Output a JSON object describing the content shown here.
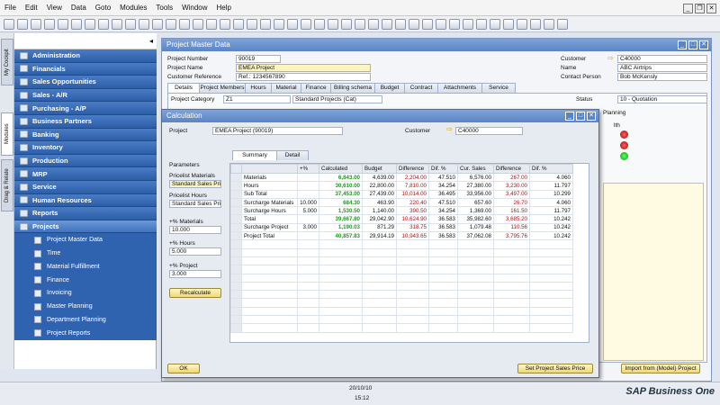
{
  "menu": [
    "File",
    "Edit",
    "View",
    "Data",
    "Goto",
    "Modules",
    "Tools",
    "Window",
    "Help"
  ],
  "sidetabs": [
    "My Cockpit",
    "Modules",
    "Drag & Relate"
  ],
  "modules": [
    "Administration",
    "Financials",
    "Sales Opportunities",
    "Sales - A/R",
    "Purchasing - A/P",
    "Business Partners",
    "Banking",
    "Inventory",
    "Production",
    "MRP",
    "Service",
    "Human Resources",
    "Reports",
    "Projects"
  ],
  "projects_sub": [
    "Project Master Data",
    "Time",
    "Material Fulfillment",
    "Finance",
    "Invoicing",
    "Master Planning",
    "Department Planning",
    "Project Reports"
  ],
  "pmd": {
    "title": "Project Master Data",
    "labels": {
      "number": "Project Number",
      "name": "Project Name",
      "ref": "Customer Reference",
      "customer": "Customer",
      "cname": "Name",
      "contact": "Contact Person",
      "category": "Project Category",
      "status": "Status",
      "planning": "Planning",
      "health": "lth"
    },
    "values": {
      "number": "90019",
      "name": "EMEA Project",
      "ref": "Ref.: 1234567890",
      "customer": "C40000",
      "cname": "ABC Airtrips",
      "contact": "Bob McKensly",
      "category": "Z1",
      "category_desc": "Standard Projects (Cat)",
      "status": "10 - Quotation"
    },
    "tabs": [
      "Details",
      "Project Members",
      "Hours",
      "Material",
      "Finance",
      "Billing schema",
      "Budget",
      "Contract",
      "Attachments",
      "Service"
    ],
    "import_btn": "Import from (Model) Project"
  },
  "calc": {
    "title": "Calculation",
    "project_label": "Project",
    "project_value": "EMEA Project (90019)",
    "customer_label": "Customer",
    "customer_value": "C40000",
    "tabs": [
      "Summary",
      "Detail"
    ],
    "params": "Parameters",
    "pricelist_mat_label": "Pricelist Materials",
    "pricelist_mat": "Standard Sales Pric",
    "pricelist_hours_label": "Pricelist Hours",
    "pricelist_hours": "Standard Sales Pric",
    "pm_label": "+% Materials",
    "pm": "10.000",
    "ph_label": "+% Hours",
    "ph": "5.000",
    "pp_label": "+% Project",
    "pp": "3.000",
    "recalc": "Recalculate",
    "ok": "OK",
    "set_price": "Set Project Sales Price",
    "columns": [
      "",
      "+%",
      "Calculated",
      "Budget",
      "Difference",
      "Dif. %",
      "Cur. Sales",
      "Difference",
      "Dif. %"
    ],
    "rows": [
      [
        "Materials",
        "",
        "6,843.00",
        "4,639.00",
        "2,204.00",
        "47.510",
        "6,576.00",
        "267.00",
        "4.060"
      ],
      [
        "Hours",
        "",
        "30,610.00",
        "22,800.00",
        "7,810.00",
        "34.254",
        "27,380.00",
        "3,230.00",
        "11.797"
      ],
      [
        "Sub Total",
        "",
        "37,453.00",
        "27,439.00",
        "10,014.00",
        "36.495",
        "33,956.00",
        "3,497.00",
        "10.299"
      ],
      [
        "Surcharge Materials",
        "10.000",
        "684.30",
        "463.90",
        "220.40",
        "47.510",
        "657.60",
        "26.70",
        "4.060"
      ],
      [
        "Surcharge Hours",
        "5.000",
        "1,530.50",
        "1,140.00",
        "390.50",
        "34.254",
        "1,369.00",
        "161.50",
        "11.797"
      ],
      [
        "Total",
        "",
        "39,667.80",
        "29,042.90",
        "10,624.90",
        "36.583",
        "35,982.60",
        "3,685.20",
        "10.242"
      ],
      [
        "Surcharge Project",
        "3.000",
        "1,190.03",
        "871.29",
        "318.75",
        "36.583",
        "1,079.48",
        "110.56",
        "10.242"
      ],
      [
        "Project Total",
        "",
        "40,857.83",
        "29,914.19",
        "10,943.65",
        "36.583",
        "37,062.08",
        "3,795.76",
        "10.242"
      ]
    ]
  },
  "status": {
    "date": "20/10/10",
    "time": "15:12",
    "brand": "SAP Business One"
  }
}
